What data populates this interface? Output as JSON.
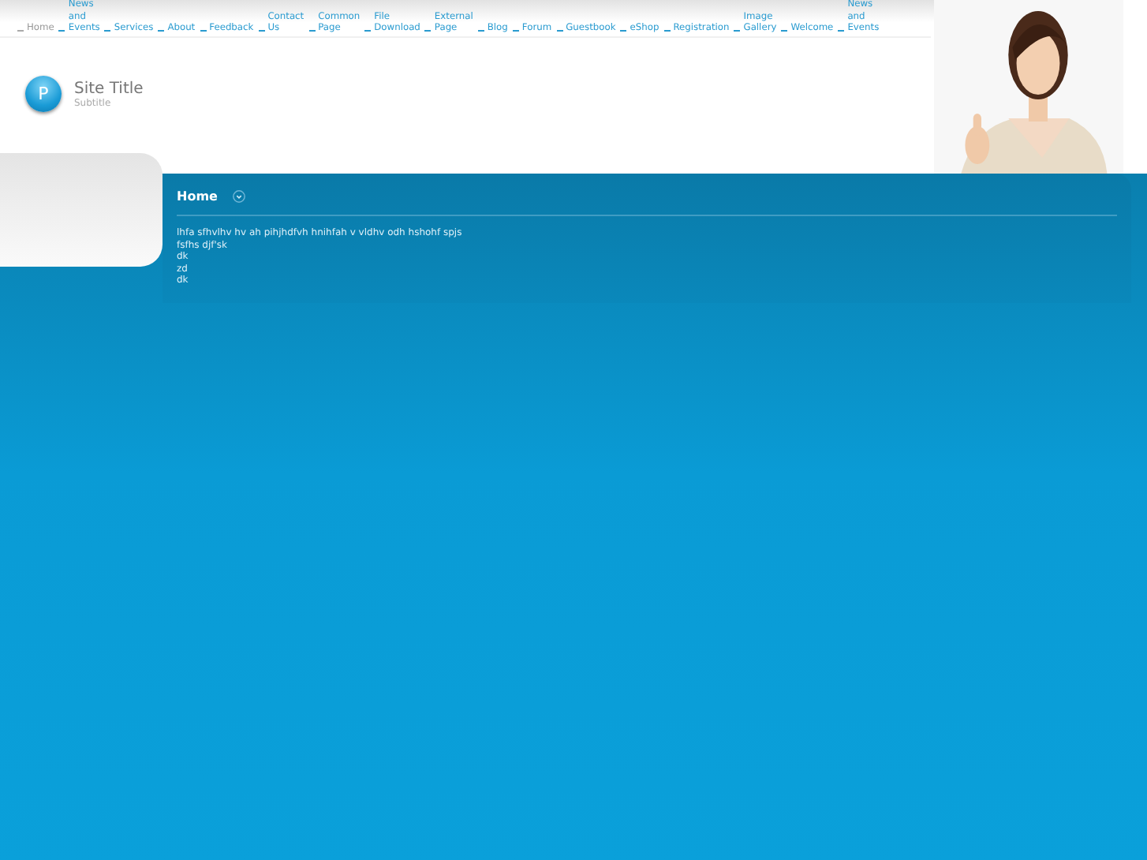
{
  "nav": [
    {
      "label": "Home",
      "selected": true
    },
    {
      "label": "News and Events",
      "selected": false
    },
    {
      "label": "Services",
      "selected": false
    },
    {
      "label": "About",
      "selected": false
    },
    {
      "label": "Feedback",
      "selected": false
    },
    {
      "label": "Contact Us",
      "selected": false
    },
    {
      "label": "Common Page",
      "selected": false
    },
    {
      "label": "File Download",
      "selected": false
    },
    {
      "label": "External Page",
      "selected": false
    },
    {
      "label": "Blog",
      "selected": false
    },
    {
      "label": "Forum",
      "selected": false
    },
    {
      "label": "Guestbook",
      "selected": false
    },
    {
      "label": "eShop",
      "selected": false
    },
    {
      "label": "Registration",
      "selected": false
    },
    {
      "label": "Image Gallery",
      "selected": false
    },
    {
      "label": "Welcome",
      "selected": false
    },
    {
      "label": "News and Events",
      "selected": false
    }
  ],
  "logo": {
    "letter": "P",
    "title": "Site Title",
    "subtitle": "Subtitle"
  },
  "content": {
    "heading": "Home",
    "lines": [
      "lhfa sfhvlhv hv ah pihjhdfvh hnihfah v vldhv odh hshohf spjs",
      "fsfhs djf'sk",
      "dk",
      "zd",
      "dk"
    ]
  }
}
